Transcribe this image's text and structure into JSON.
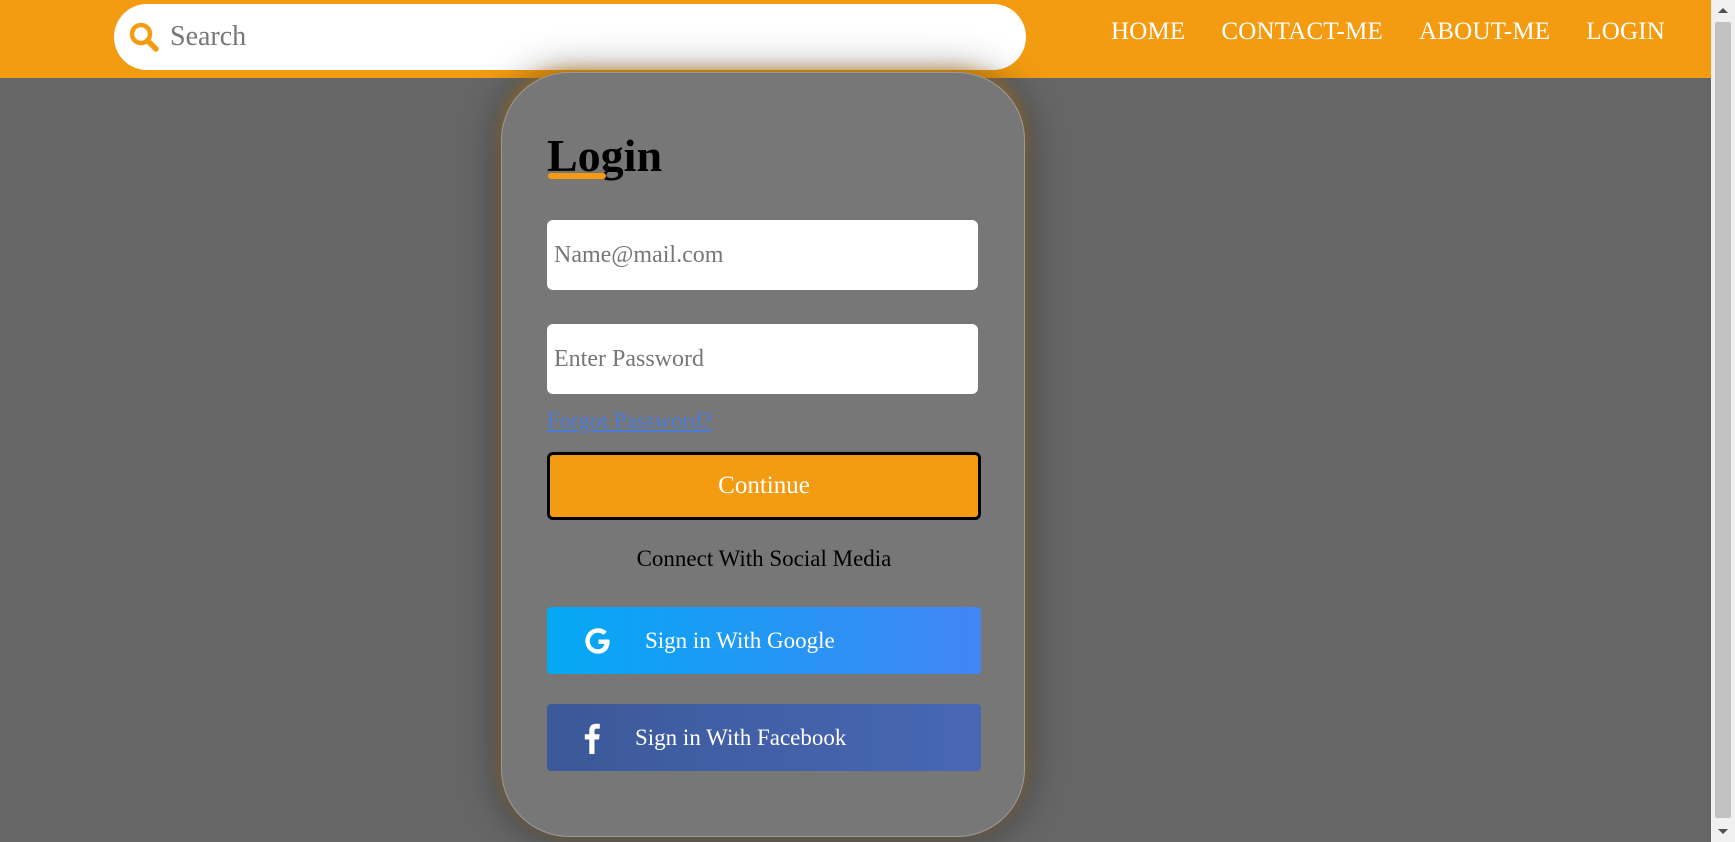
{
  "header": {
    "search_placeholder": "Search",
    "nav": [
      "HOME",
      "CONTACT-ME",
      "ABOUT-ME",
      "LOGIN"
    ]
  },
  "login": {
    "title": "Login",
    "email_placeholder": "Name@mail.com",
    "password_placeholder": "Enter Password",
    "forgot_label": "Forgot Password?",
    "continue_label": "Continue",
    "social_title": "Connect With Social Media",
    "google_label": "Sign in With Google",
    "facebook_label": "Sign in With Facebook"
  },
  "icons": {
    "search": "search-icon",
    "google": "google-icon",
    "facebook": "facebook-icon"
  },
  "colors": {
    "accent": "#f39c12",
    "background": "#666666",
    "card": "#777777",
    "google_start": "#03a9f4",
    "google_end": "#4285f4",
    "facebook_start": "#3b5998",
    "facebook_end": "#4867b5",
    "link": "#4a7bd8"
  }
}
